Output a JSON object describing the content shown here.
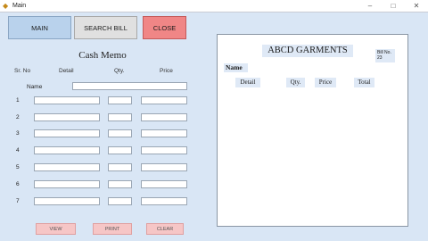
{
  "window": {
    "title": "Main",
    "minimize": "–",
    "maximize": "□",
    "close": "✕"
  },
  "nav": {
    "main": "MAIN",
    "search_bill": "SEARCH BILL",
    "close": "CLOSE"
  },
  "memo": {
    "title": "Cash Memo",
    "columns": {
      "sr_no": "Sr. No",
      "detail": "Detail",
      "qty": "Qty.",
      "price": "Price"
    },
    "name_label": "Name",
    "name_value": "",
    "rows": [
      {
        "no": "1",
        "detail": "",
        "qty": "",
        "price": ""
      },
      {
        "no": "2",
        "detail": "",
        "qty": "",
        "price": ""
      },
      {
        "no": "3",
        "detail": "",
        "qty": "",
        "price": ""
      },
      {
        "no": "4",
        "detail": "",
        "qty": "",
        "price": ""
      },
      {
        "no": "5",
        "detail": "",
        "qty": "",
        "price": ""
      },
      {
        "no": "6",
        "detail": "",
        "qty": "",
        "price": ""
      },
      {
        "no": "7",
        "detail": "",
        "qty": "",
        "price": ""
      }
    ]
  },
  "actions": {
    "view": "VIEW",
    "print": "PRINT",
    "clear": "CLEAR"
  },
  "bill": {
    "company": "ABCD GARMENTS",
    "bill_no_label": "Bill No.",
    "bill_no_value": "23",
    "name_label": "Name",
    "columns": {
      "detail": "Detail",
      "qty": "Qty.",
      "price": "Price",
      "total": "Total"
    }
  },
  "colors": {
    "background": "#d9e6f5",
    "main_button": "#b9d2ec",
    "close_button": "#f08686",
    "action_button": "#f6c6c6"
  }
}
